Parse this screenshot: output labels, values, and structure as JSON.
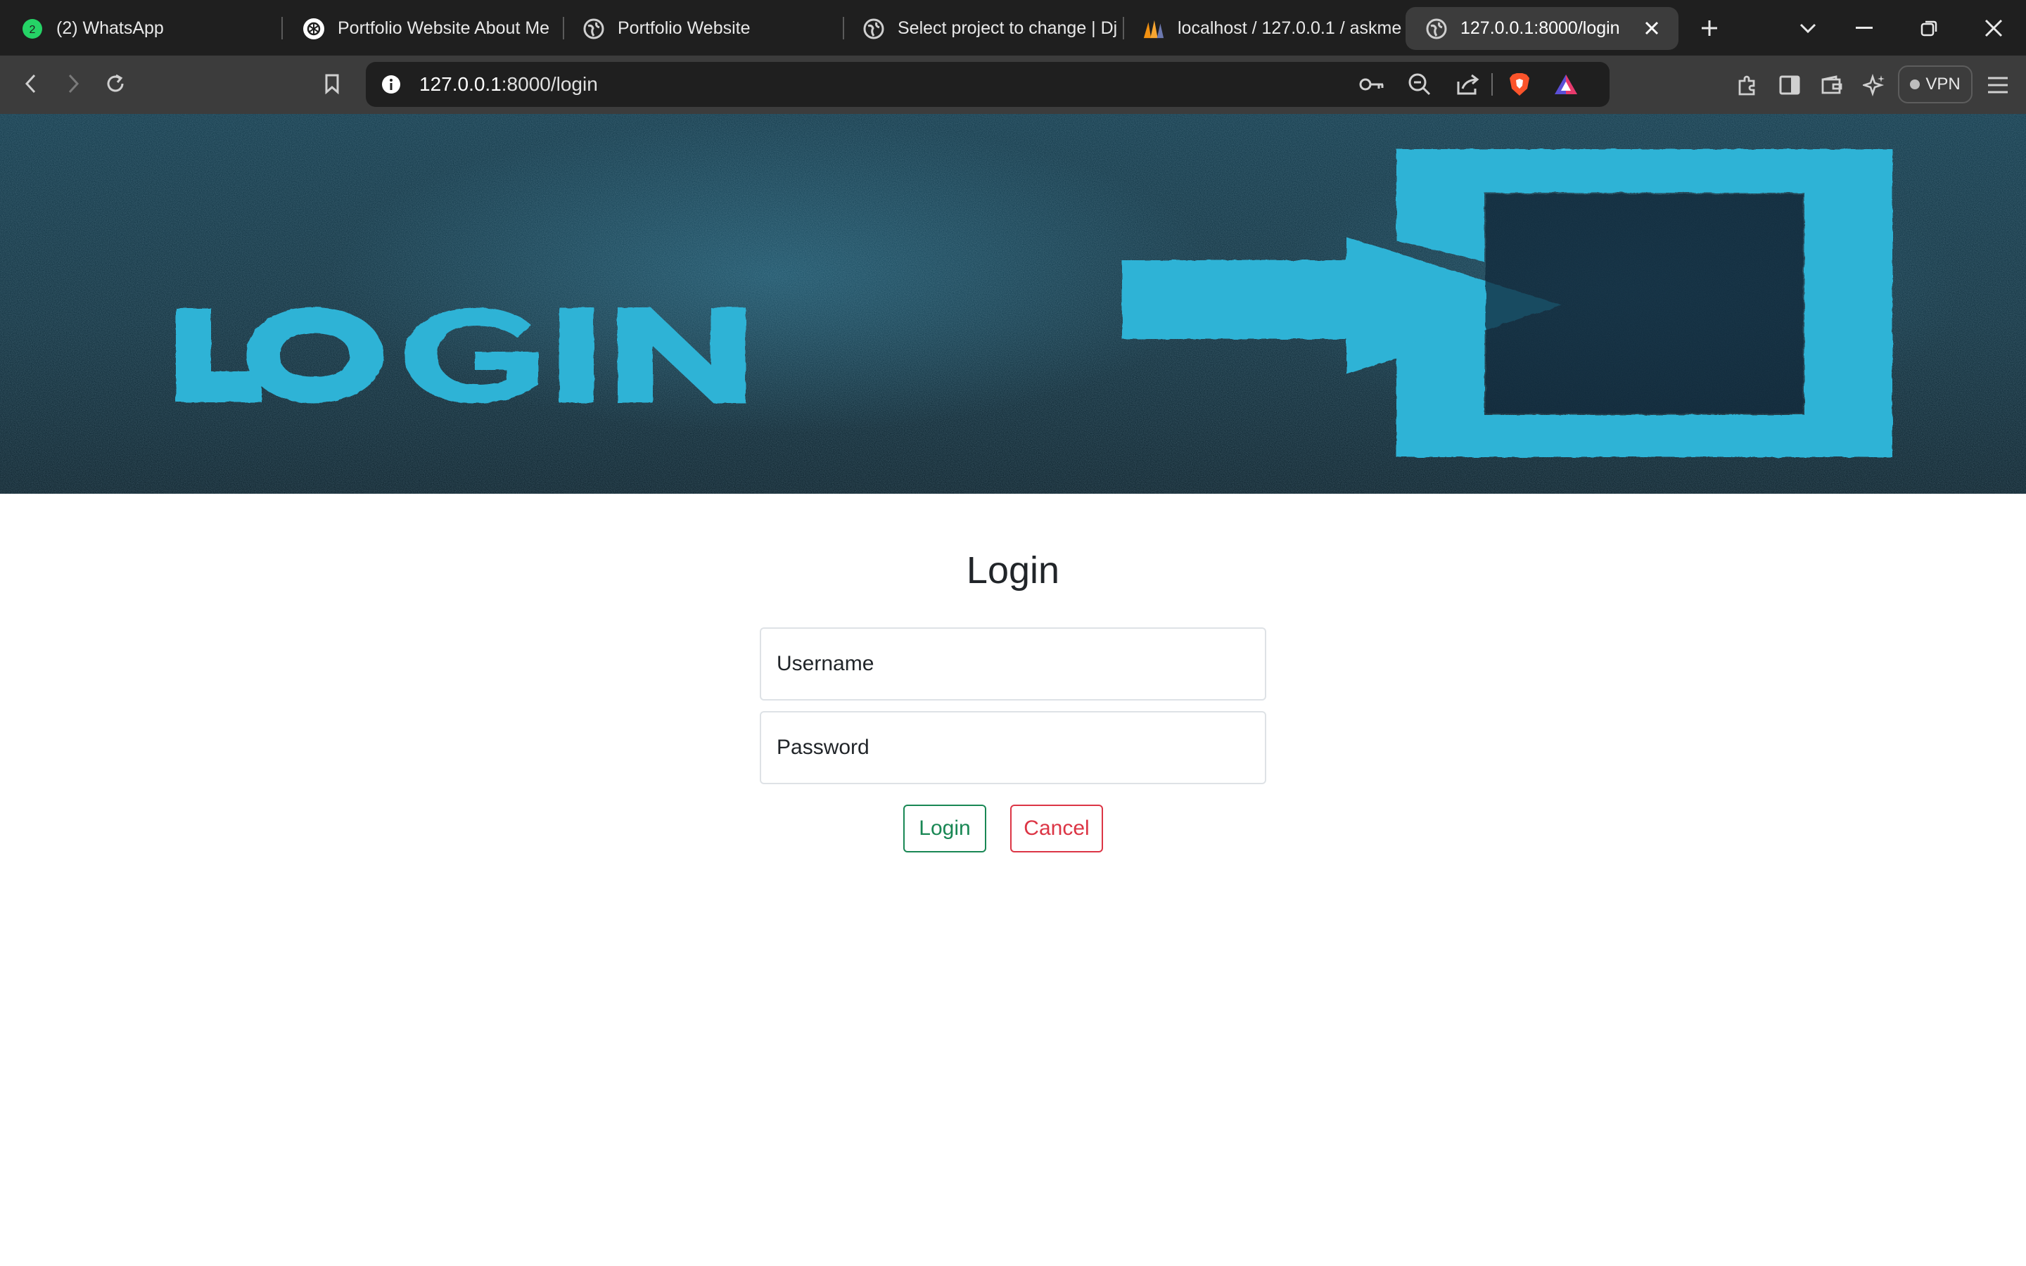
{
  "browser": {
    "tabs": [
      {
        "title": "(2) WhatsApp",
        "icon": "whatsapp-icon",
        "badge": "2",
        "active": false
      },
      {
        "title": "Portfolio Website About Me",
        "icon": "chatgpt-icon",
        "active": false
      },
      {
        "title": "Portfolio Website",
        "icon": "globe-icon",
        "active": false
      },
      {
        "title": "Select project to change | Dj",
        "icon": "globe-icon",
        "active": false
      },
      {
        "title": "localhost / 127.0.0.1 / askme",
        "icon": "phpmyadmin-icon",
        "active": false
      },
      {
        "title": "127.0.0.1:8000/login",
        "icon": "globe-icon",
        "active": true
      }
    ],
    "address": {
      "host": "127.0.0.1",
      "rest": ":8000/login"
    },
    "vpn_label": "VPN",
    "colors": {
      "chrome_dark": "#1f1f1f",
      "chrome_toolbar": "#3c3c3c",
      "brave_orange": "#fb542b"
    }
  },
  "banner": {
    "text": "LOGIN",
    "colors": {
      "background": "#0b2a38",
      "accent": "#2fb3d6"
    }
  },
  "login_form": {
    "title": "Login",
    "username_placeholder": "Username",
    "password_placeholder": "Password",
    "login_button": "Login",
    "cancel_button": "Cancel",
    "colors": {
      "login": "#198754",
      "cancel": "#dc3545",
      "border": "#dee2e6"
    }
  }
}
